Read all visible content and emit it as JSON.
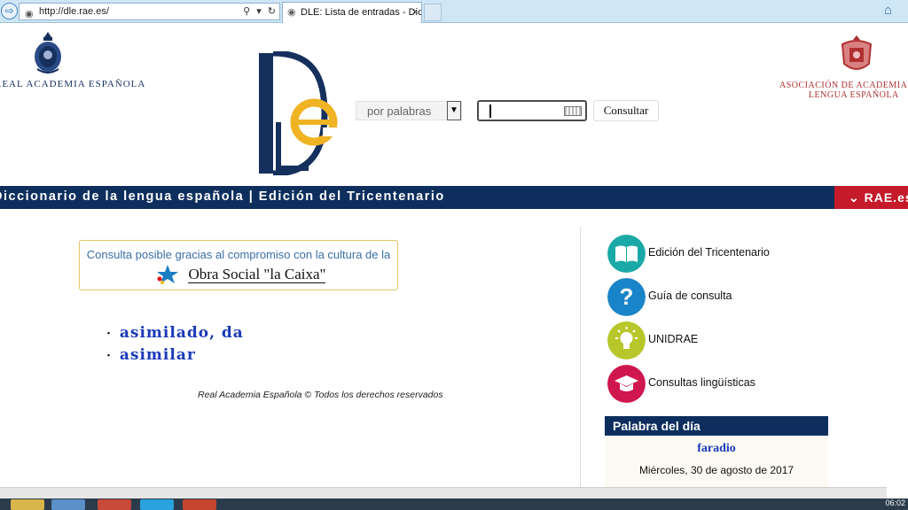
{
  "browser": {
    "address_url": "http://dle.rae.es/",
    "tab_title": "DLE: Lista de entradas - Dic...",
    "tab_close": "×"
  },
  "header": {
    "rae_name": "REAL ACADEMIA ESPAÑOLA",
    "asale_line1": "ASOCIACIÓN DE ACADEMIAS DE",
    "asale_line2": "LENGUA ESPAÑOLA",
    "search_mode": "por palabras",
    "search_value": "",
    "search_button": "Consultar"
  },
  "navbar": {
    "title": "Diccionario de la lengua española | Edición del Tricentenario",
    "rae_link": "RAE.es",
    "rae_chevron": "⌄"
  },
  "main": {
    "sponsor_text": "Consulta posible gracias al compromiso con la cultura de la",
    "sponsor_brand": "Obra Social \"la Caixa\"",
    "results": [
      "asimilado, da",
      "asimilar"
    ],
    "bullet": "·",
    "footer": "Real Academia Española © Todos los derechos reservados"
  },
  "sidebar": {
    "items": [
      {
        "label": "Edición del Tricentenario",
        "icon": "book-icon",
        "color": "#1aa9a6"
      },
      {
        "label": "Guía de consulta",
        "icon": "question-icon",
        "color": "#1a84c8"
      },
      {
        "label": "UNIDRAE",
        "icon": "lightbulb-icon",
        "color": "#b7c72a"
      },
      {
        "label": "Consultas lingüísticas",
        "icon": "graduation-cap-icon",
        "color": "#d0174d"
      }
    ],
    "word_of_day": {
      "heading": "Palabra del día",
      "word": "faradio",
      "date": "Miércoles, 30 de agosto de 2017"
    }
  },
  "taskbar": {
    "clock": "06:02"
  },
  "colors": {
    "navy": "#0e2f5e",
    "rae_red": "#c41a2a",
    "link_blue": "#1a3ab8",
    "dle_gold": "#f0b323"
  }
}
